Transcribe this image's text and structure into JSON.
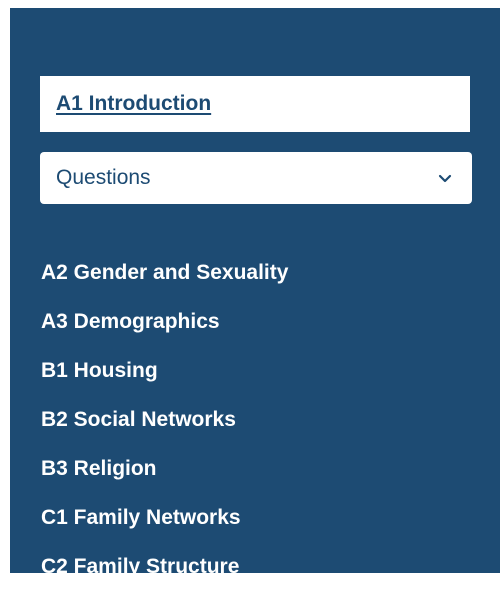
{
  "sidebar": {
    "current_item": "A1 Introduction",
    "section_select": {
      "selected": "Questions",
      "icon": "chevron-down-icon"
    },
    "items": [
      {
        "label": "A2 Gender and Sexuality"
      },
      {
        "label": "A3 Demographics"
      },
      {
        "label": "B1 Housing"
      },
      {
        "label": "B2 Social Networks"
      },
      {
        "label": "B3 Religion"
      },
      {
        "label": "C1 Family Networks"
      },
      {
        "label": "C2 Family Structure"
      }
    ]
  },
  "colors": {
    "sidebar_background": "#1d4b73",
    "text_on_dark": "#ffffff",
    "text_on_light": "#1d4b73",
    "page_background": "#ffffff"
  }
}
